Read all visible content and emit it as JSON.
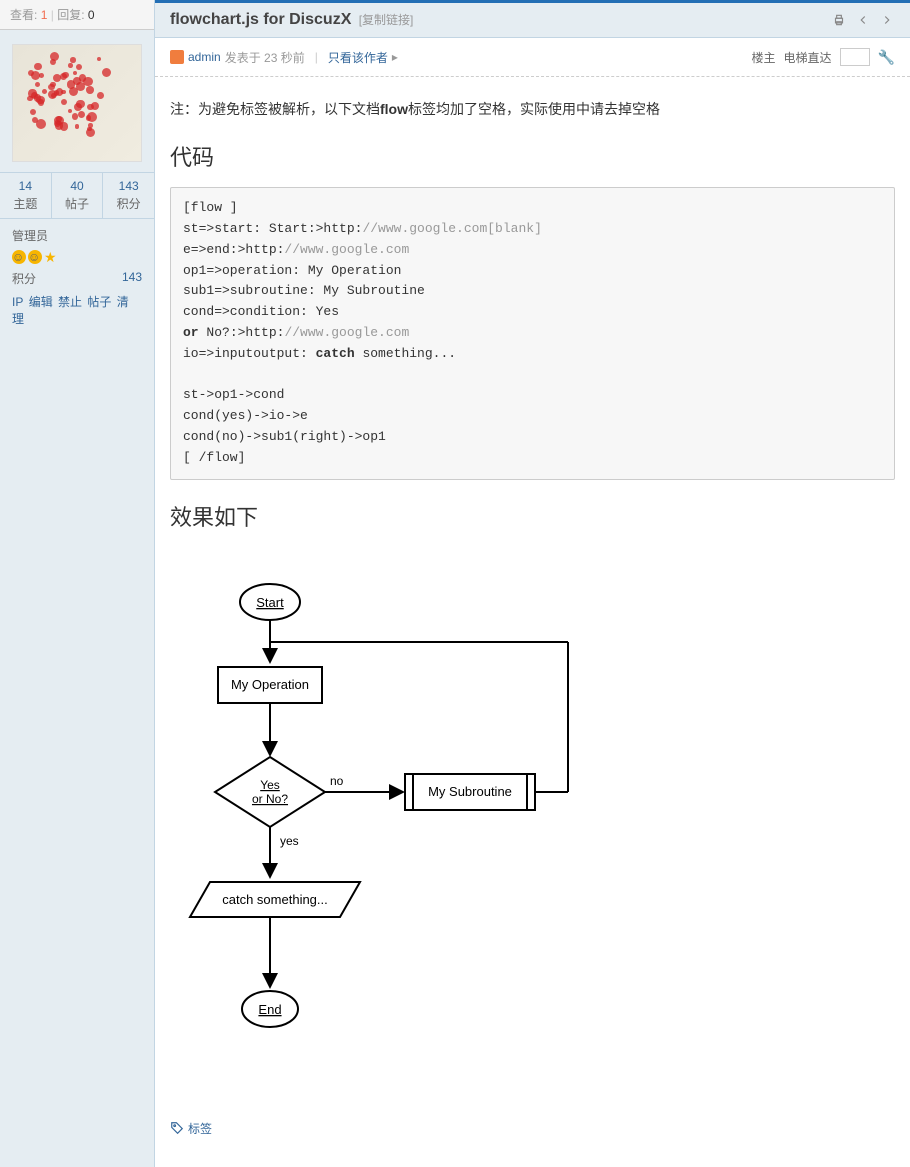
{
  "sidebar_top": {
    "view_label": "查看:",
    "view_count": "1",
    "reply_label": "回复:",
    "reply_count": "0"
  },
  "stats": [
    {
      "num": "14",
      "label": "主题"
    },
    {
      "num": "40",
      "label": "帖子"
    },
    {
      "num": "143",
      "label": "积分"
    }
  ],
  "user": {
    "role": "管理员",
    "score_label": "积分",
    "score_value": "143",
    "mod_links": [
      "IP",
      "编辑",
      "禁止",
      "帖子",
      "清理"
    ]
  },
  "header": {
    "title": "flowchart.js for DiscuzX",
    "copy_link": "[复制链接]"
  },
  "post_meta": {
    "author": "admin",
    "posted": "发表于 23 秒前",
    "only_author": "只看该作者",
    "floor": "楼主",
    "elevator": "电梯直达"
  },
  "body": {
    "note_prefix": "注：为避免标签被解析，以下文档",
    "note_bold": "flow",
    "note_suffix": "标签均加了空格，实际使用中请去掉空格",
    "code_title": "代码",
    "effect_title": "效果如下",
    "tag_label": "标签"
  },
  "code": {
    "l1a": "[flow ]",
    "l2a": "st=>start: Start:>http:",
    "l2b": "//www.google.com[blank]",
    "l3a": "e=>end:>http:",
    "l3b": "//www.google.com",
    "l4": "op1=>operation: My Operation",
    "l5": "sub1=>subroutine: My Subroutine",
    "l6": "cond=>condition: Yes",
    "l7a": "or",
    "l7b": " No?:>http:",
    "l7c": "//www.google.com",
    "l8a": "io=>inputoutput: ",
    "l8b": "catch",
    "l8c": " something...",
    "l9": "st->op1->cond",
    "l10": "cond(yes)->io->e",
    "l11": "cond(no)->sub1(right)->op1",
    "l12": "[ /flow]"
  },
  "chart_data": {
    "type": "flowchart",
    "nodes": [
      {
        "id": "st",
        "type": "start",
        "text": "Start"
      },
      {
        "id": "op1",
        "type": "operation",
        "text": "My Operation"
      },
      {
        "id": "cond",
        "type": "condition",
        "text": "Yes or No?"
      },
      {
        "id": "sub1",
        "type": "subroutine",
        "text": "My Subroutine"
      },
      {
        "id": "io",
        "type": "inputoutput",
        "text": "catch something..."
      },
      {
        "id": "e",
        "type": "end",
        "text": "End"
      }
    ],
    "edges": [
      {
        "from": "st",
        "to": "op1"
      },
      {
        "from": "op1",
        "to": "cond"
      },
      {
        "from": "cond",
        "to": "io",
        "label": "yes"
      },
      {
        "from": "cond",
        "to": "sub1",
        "label": "no",
        "direction": "right"
      },
      {
        "from": "sub1",
        "to": "op1"
      },
      {
        "from": "io",
        "to": "e"
      }
    ]
  }
}
